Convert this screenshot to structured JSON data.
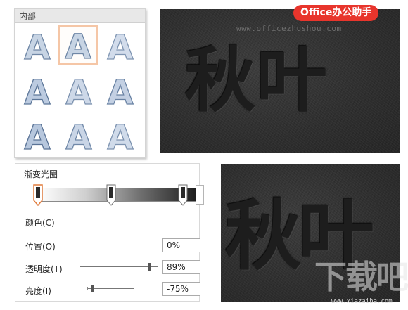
{
  "gallery": {
    "header": "内部",
    "preset_letter": "A",
    "selected_index": 1
  },
  "gradient_options": {
    "title": "渐变光圈",
    "color_label": "颜色(C)",
    "position_label": "位置(O)",
    "position_value": "0%",
    "transparency_label": "透明度(T)",
    "transparency_value": "89%",
    "transparency_level": 0.89,
    "brightness_label": "亮度(I)",
    "brightness_value": "-75%",
    "brightness_level": -0.75
  },
  "results": {
    "top_text": "秋叶",
    "bottom_text": "秋叶"
  },
  "watermarks": {
    "brand_badge": "Office办公助手",
    "site_url": "www.officezhushou.com",
    "logo_text": "下载吧",
    "logo_url": "www.xiazaiba.com"
  },
  "colors": {
    "brand_red": "#e8352c",
    "selection_border": "#f5c6a6",
    "active_stop": "#e07b3c",
    "dark_bg": "#2e2e2e"
  }
}
